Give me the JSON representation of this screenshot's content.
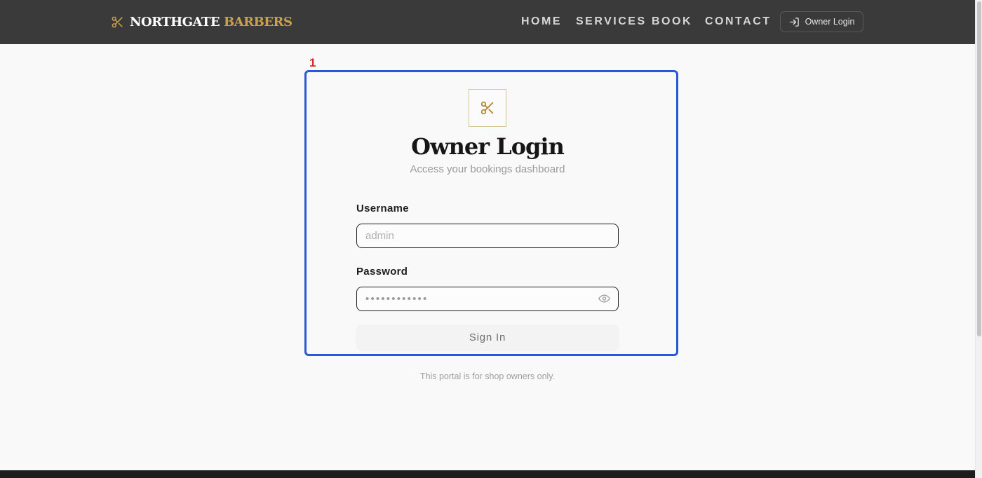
{
  "brand": {
    "name_part1": "NORTHGATE",
    "name_part2": "BARBERS",
    "icon": "scissors-icon",
    "accent_color": "#c9a14a"
  },
  "nav": {
    "links": [
      {
        "label": "HOME"
      },
      {
        "label": "SERVICES"
      },
      {
        "label": "BOOK"
      },
      {
        "label": "CONTACT"
      }
    ],
    "owner_login_label": "Owner Login",
    "owner_login_icon": "login-icon"
  },
  "annotation": {
    "marker": "1",
    "highlight_color": "#2b58d6"
  },
  "login": {
    "icon": "scissors-icon",
    "title": "Owner Login",
    "subtitle": "Access your bookings dashboard",
    "username_label": "Username",
    "username_placeholder": "admin",
    "password_label": "Password",
    "password_masked": "••••••••••••",
    "password_toggle_icon": "eye-icon",
    "submit_label": "Sign In",
    "note": "This portal is for shop owners only."
  }
}
